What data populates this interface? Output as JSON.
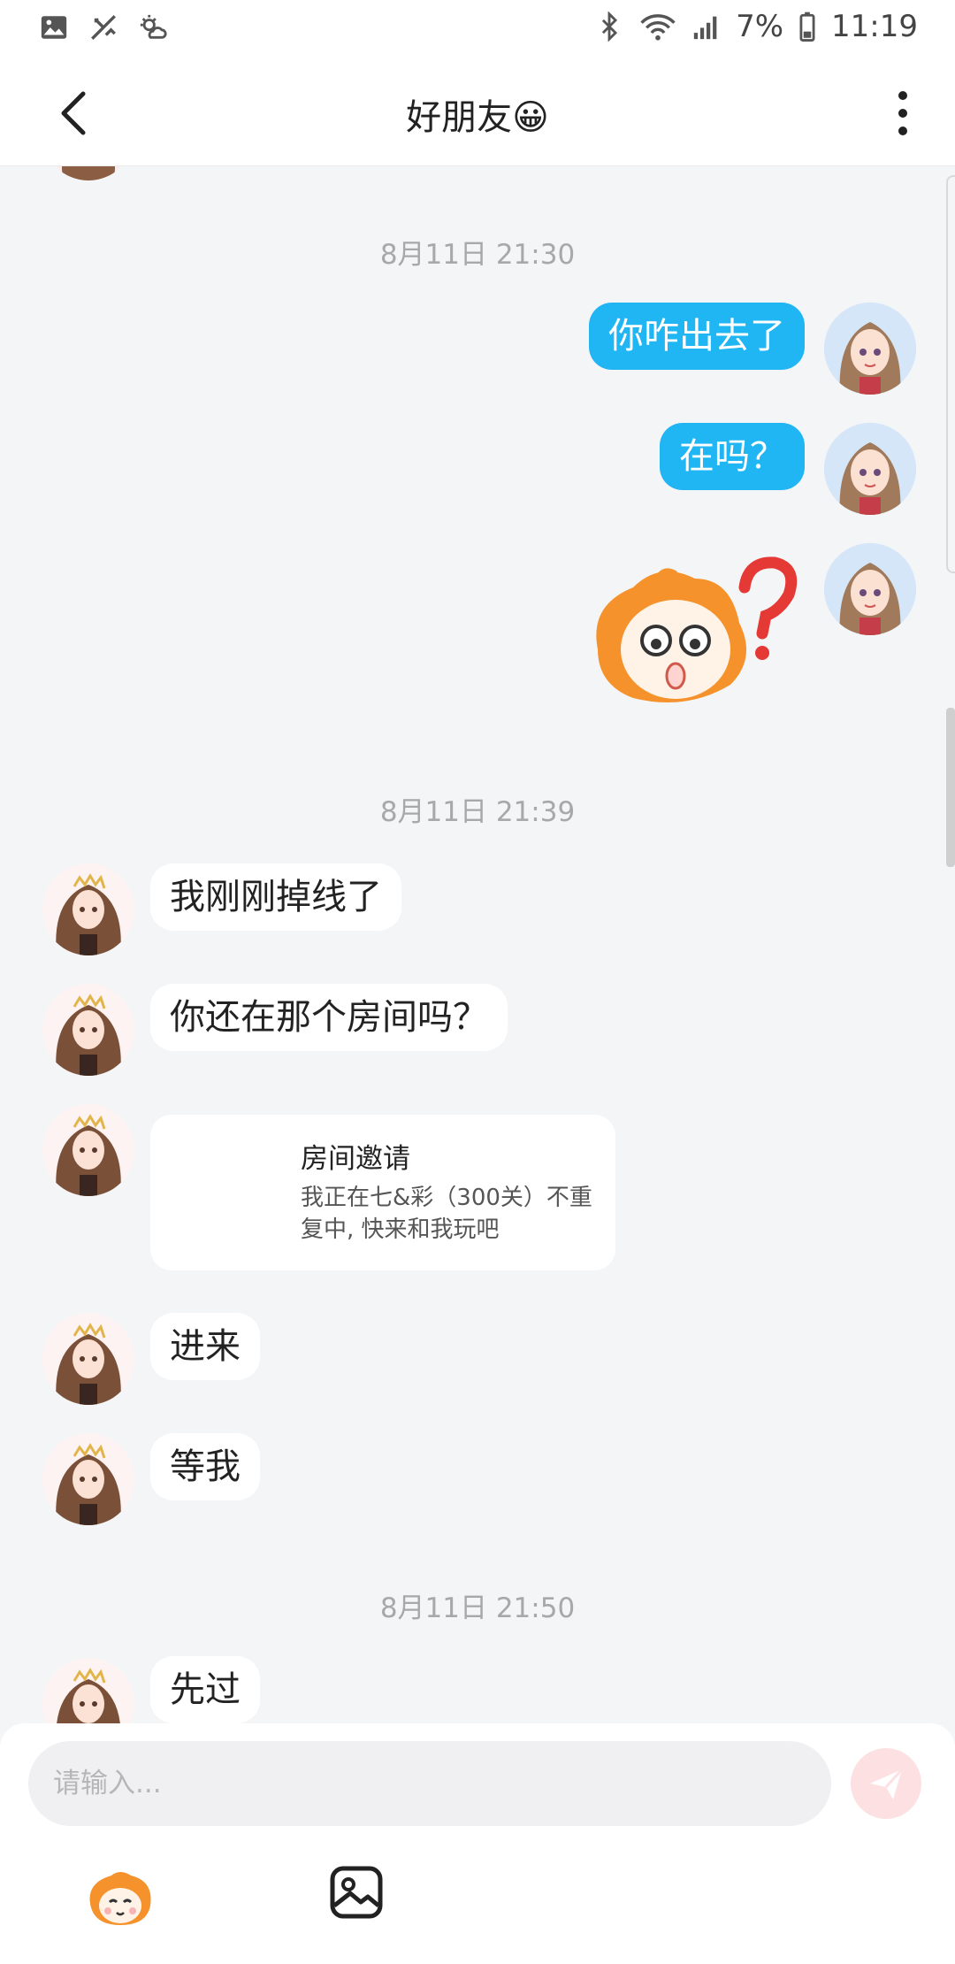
{
  "status_bar": {
    "battery": "7%",
    "time": "11:19",
    "icons": [
      "gallery-icon",
      "missed-call-icon",
      "weather-icon",
      "bluetooth-icon",
      "wifi-icon",
      "signal-icon",
      "battery-icon"
    ]
  },
  "header": {
    "title": "好朋友😀",
    "back_icon": "chevron-left-icon",
    "more_icon": "more-vertical-icon"
  },
  "messages": {
    "ts1": "8月11日 21:30",
    "me1": "你咋出去了",
    "me2": "在吗？",
    "me3_sticker": "confused-mascot-sticker",
    "ts2": "8月11日 21:39",
    "f1": "我刚刚掉线了",
    "f2": "你还在那个房间吗？",
    "invite": {
      "title": "房间邀请",
      "desc": "我正在七&彩（300关）不重复中, 快来和我玩吧"
    },
    "f3": "进来",
    "f4": "等我",
    "ts3": "8月11日 21:50",
    "f5": "先过"
  },
  "composer": {
    "placeholder": "请输入...",
    "send_icon": "paper-plane-icon",
    "emoji_icon": "mascot-sticker-icon",
    "image_icon": "image-icon"
  },
  "colors": {
    "accent": "#20b5f3",
    "background": "#f4f5f7",
    "send_disabled": "#fde0e2"
  }
}
